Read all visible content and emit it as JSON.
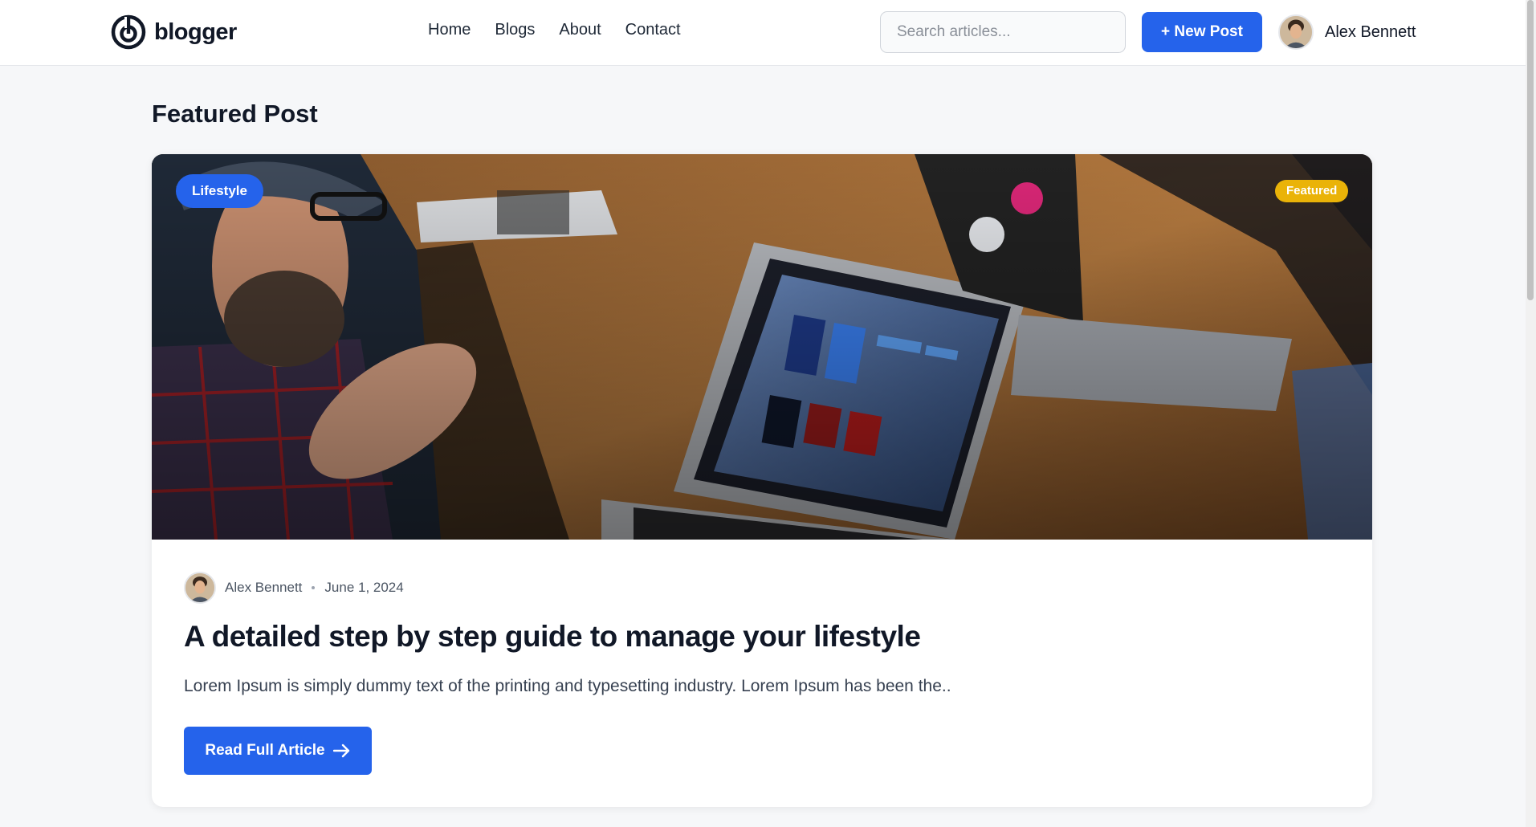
{
  "header": {
    "logo_text": "blogger",
    "logo_icon": "spiral-logo-icon",
    "nav": [
      {
        "label": "Home"
      },
      {
        "label": "Blogs"
      },
      {
        "label": "About"
      },
      {
        "label": "Contact"
      }
    ],
    "search": {
      "placeholder": "Search articles...",
      "value": ""
    },
    "new_post_label": "+ New Post",
    "user_name": "Alex Bennett"
  },
  "featured": {
    "section_title": "Featured Post",
    "category_badge": "Lifestyle",
    "featured_badge": "Featured",
    "author": "Alex Bennett",
    "date": "June 1, 2024",
    "title": "A detailed step by step guide to manage your lifestyle",
    "excerpt": "Lorem Ipsum is simply dummy text of the printing and typesetting industry. Lorem Ipsum has been the..",
    "cta_label": "Read Full Article",
    "cta_icon": "arrow-right-icon"
  },
  "colors": {
    "accent": "#2563eb",
    "featured_badge": "#eab308",
    "page_background": "#f6f7f9"
  }
}
